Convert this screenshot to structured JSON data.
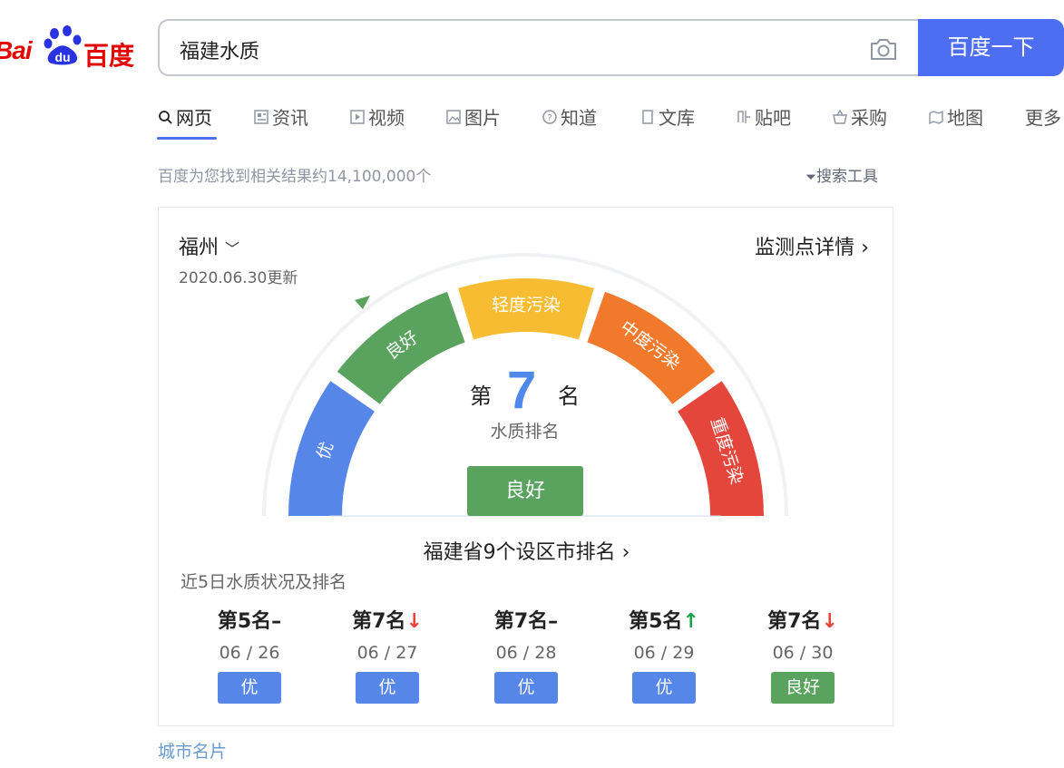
{
  "logo": {
    "bai": "Bai",
    "du": "du",
    "cn": "百度"
  },
  "search": {
    "query": "福建水质",
    "button": "百度一下"
  },
  "tabs": [
    {
      "label": "网页",
      "icon": "search-icon"
    },
    {
      "label": "资讯",
      "icon": "news-icon"
    },
    {
      "label": "视频",
      "icon": "video-icon"
    },
    {
      "label": "图片",
      "icon": "image-icon"
    },
    {
      "label": "知道",
      "icon": "question-icon"
    },
    {
      "label": "文库",
      "icon": "document-icon"
    },
    {
      "label": "贴吧",
      "icon": "tieba-icon"
    },
    {
      "label": "采购",
      "icon": "basket-icon"
    },
    {
      "label": "地图",
      "icon": "map-icon"
    },
    {
      "label": "更多",
      "icon": ""
    }
  ],
  "results": {
    "count_text": "百度为您找到相关结果约14,100,000个",
    "tools": "搜索工具"
  },
  "card": {
    "city": "福州",
    "updated": "2020.06.30更新",
    "detail": "监测点详情",
    "gauge_segments": [
      {
        "label": "优",
        "color": "#5686e8"
      },
      {
        "label": "良好",
        "color": "#5aa35f"
      },
      {
        "label": "轻度污染",
        "color": "#f7bc31"
      },
      {
        "label": "中度污染",
        "color": "#f1792b"
      },
      {
        "label": "重度污染",
        "color": "#e4463c"
      }
    ],
    "rank_pre": "第",
    "rank_num": "7",
    "rank_post": "名",
    "rank_label": "水质排名",
    "status": "良好",
    "province_rank": "福建省9个设区市排名",
    "recent_title": "近5日水质状况及排名",
    "days": [
      {
        "rank": "第5名",
        "trend": "–",
        "trend_color": "#222222",
        "date": "06 / 26",
        "quality": "优",
        "color": "#5686e8"
      },
      {
        "rank": "第7名",
        "trend": "↓",
        "trend_color": "#e4463c",
        "date": "06 / 27",
        "quality": "优",
        "color": "#5686e8"
      },
      {
        "rank": "第7名",
        "trend": "–",
        "trend_color": "#222222",
        "date": "06 / 28",
        "quality": "优",
        "color": "#5686e8"
      },
      {
        "rank": "第5名",
        "trend": "↑",
        "trend_color": "#1aa34a",
        "date": "06 / 29",
        "quality": "优",
        "color": "#5686e8"
      },
      {
        "rank": "第7名",
        "trend": "↓",
        "trend_color": "#e4463c",
        "date": "06 / 30",
        "quality": "良好",
        "color": "#5aa35f"
      }
    ]
  },
  "more": "城市名片"
}
